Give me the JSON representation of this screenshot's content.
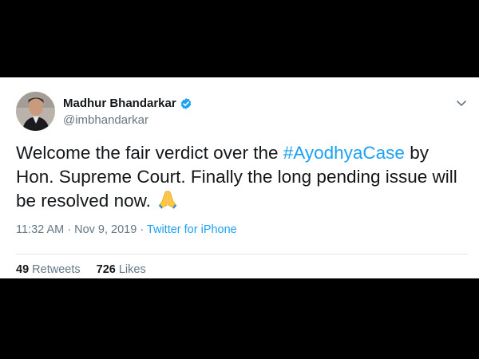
{
  "tweet": {
    "author": {
      "name": "Madhur Bhandarkar",
      "handle": "@imbhandarkar",
      "verified": true
    },
    "text": {
      "before": "Welcome the fair verdict over the ",
      "hashtag": "#AyodhyaCase",
      "after": " by Hon. Supreme Court. Finally the long pending issue will be resolved now.",
      "emoji": "folded-hands-emoji"
    },
    "time": "11:32 AM",
    "separator": " · ",
    "date": "Nov 9, 2019",
    "source": "Twitter for iPhone",
    "retweets": {
      "count": "49",
      "label": "Retweets"
    },
    "likes": {
      "count": "726",
      "label": "Likes"
    }
  },
  "colors": {
    "link": "#1da1f2",
    "secondary_text": "#657786",
    "primary_text": "#14171a",
    "background": "#000000"
  },
  "icons": [
    "verified-badge-icon",
    "chevron-down-icon",
    "folded-hands-emoji"
  ]
}
